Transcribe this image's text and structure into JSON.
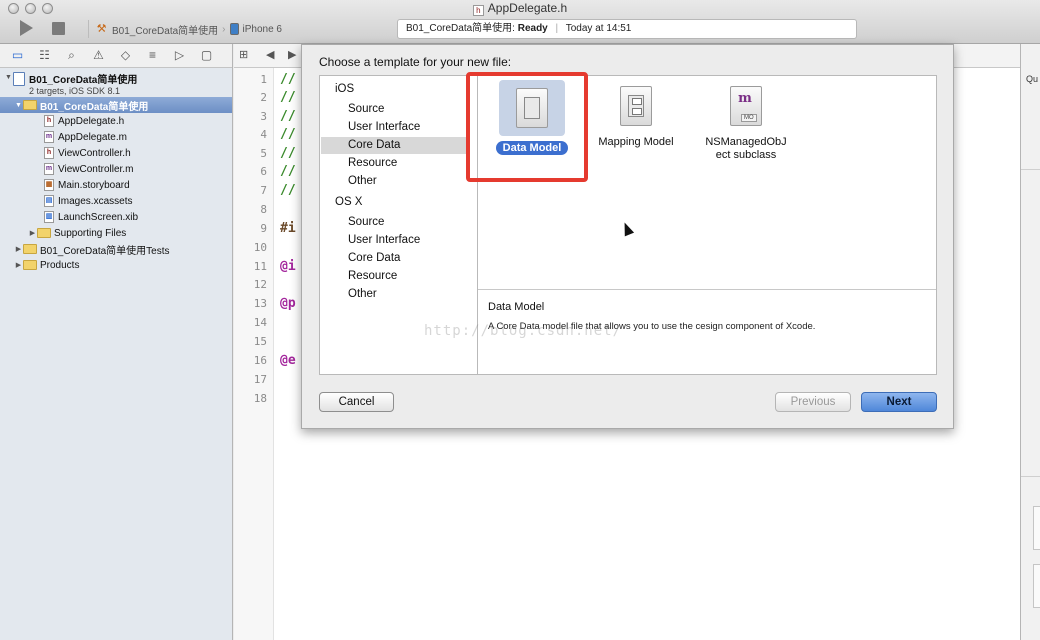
{
  "window": {
    "title": "AppDelegate.h",
    "scheme_name": "B01_CoreData简单使用",
    "device": "iPhone 6",
    "status_project": "B01_CoreData简单使用:",
    "status_state": "Ready",
    "status_time": "Today at 14:51"
  },
  "navigator": {
    "project_name": "B01_CoreData简单使用",
    "project_subtitle": "2 targets, iOS SDK 8.1",
    "group_name": "B01_CoreData简单使用",
    "files": [
      {
        "name": "AppDelegate.h",
        "icon": "h-file-icon"
      },
      {
        "name": "AppDelegate.m",
        "icon": "m-file-icon"
      },
      {
        "name": "ViewController.h",
        "icon": "h-file-icon"
      },
      {
        "name": "ViewController.m",
        "icon": "m-file-icon"
      },
      {
        "name": "Main.storyboard",
        "icon": "storyboard-icon"
      },
      {
        "name": "Images.xcassets",
        "icon": "xcassets-icon"
      },
      {
        "name": "LaunchScreen.xib",
        "icon": "xib-icon"
      }
    ],
    "supporting_files": "Supporting Files",
    "tests_group": "B01_CoreData简单使用Tests",
    "products_group": "Products"
  },
  "editor": {
    "line_numbers": [
      "1",
      "2",
      "3",
      "4",
      "5",
      "6",
      "7",
      "8",
      "9",
      "10",
      "11",
      "12",
      "13",
      "14",
      "15",
      "16",
      "17",
      "18"
    ],
    "code_fragments": {
      "comment": "//",
      "import": "#i",
      "interface": "@i",
      "property": "@p",
      "end": "@e"
    }
  },
  "utility": {
    "label": "Qu"
  },
  "dialog": {
    "title": "Choose a template for your new file:",
    "groups": [
      {
        "name": "iOS",
        "items": [
          "Source",
          "User Interface",
          "Core Data",
          "Resource",
          "Other"
        ]
      },
      {
        "name": "OS X",
        "items": [
          "Source",
          "User Interface",
          "Core Data",
          "Resource",
          "Other"
        ]
      }
    ],
    "selected_category": "Core Data",
    "templates": [
      {
        "label": "Data Model",
        "icon": "data-model-icon",
        "selected": true
      },
      {
        "label": "Mapping Model",
        "icon": "mapping-model-icon",
        "selected": false
      },
      {
        "label1": "NSManagedObJ",
        "label2": "ect subclass",
        "icon": "managed-object-icon",
        "badge": "MO",
        "selected": false
      }
    ],
    "description_title": "Data Model",
    "description_body": "A Core Data model file that allows you to use the cesign component of Xcode.",
    "watermark": "http://blog.csdn.net/",
    "buttons": {
      "cancel": "Cancel",
      "previous": "Previous",
      "next": "Next"
    }
  }
}
